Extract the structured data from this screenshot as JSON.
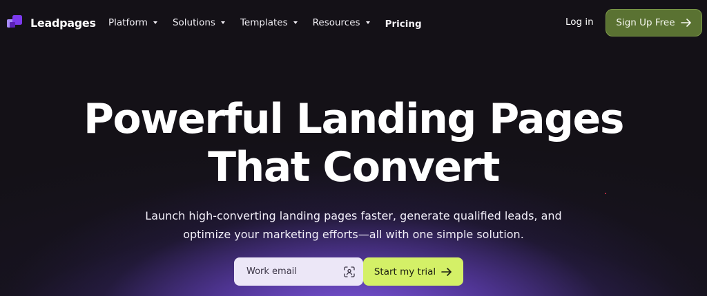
{
  "header": {
    "logo_text": "Leadpages",
    "nav": [
      {
        "label": "Platform",
        "has_dropdown": true
      },
      {
        "label": "Solutions",
        "has_dropdown": true
      },
      {
        "label": "Templates",
        "has_dropdown": true
      },
      {
        "label": "Resources",
        "has_dropdown": true
      },
      {
        "label": "Pricing",
        "has_dropdown": false
      }
    ],
    "login_label": "Log in",
    "signup_label": "Sign Up Free"
  },
  "hero": {
    "title_line1": "Powerful Landing Pages",
    "title_line2": "That Convert",
    "subtitle_line1": "Launch high-converting landing pages faster, generate qualified leads, and",
    "subtitle_line2": "optimize your marketing efforts—all with one simple solution.",
    "email_placeholder": "Work email",
    "cta_label": "Start my trial"
  },
  "icons": {
    "logo": "leadpages-logo-icon",
    "dropdown": "chevron-down-icon",
    "arrow": "arrow-right-icon",
    "scan": "contact-scan-icon"
  },
  "colors": {
    "background": "#141117",
    "glow": "#845ce8",
    "signup_bg": "#5a7232",
    "cta_bg": "#d4f067",
    "input_bg": "#ece7f7",
    "logo_accent": "#8b5cf6"
  }
}
